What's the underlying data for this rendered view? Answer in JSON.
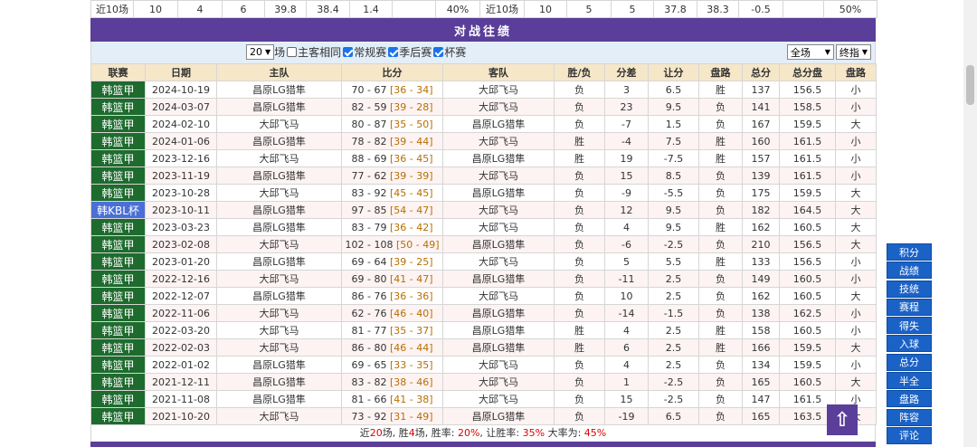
{
  "prev_row": [
    "近10场",
    "10",
    "4",
    "6",
    "39.8",
    "38.4",
    "1.4",
    "",
    "40%",
    "近10场",
    "10",
    "5",
    "5",
    "37.8",
    "38.3",
    "-0.5",
    "",
    "50%"
  ],
  "section_title": "对战往绩",
  "filters": {
    "count_select": "20",
    "count_suffix": "场",
    "same_home_label": "主客相同",
    "regular_label": "常规赛",
    "playoff_label": "季后赛",
    "cup_label": "杯赛",
    "venue_select": "全场",
    "odds_select": "终指"
  },
  "headers": [
    "联赛",
    "日期",
    "主队",
    "比分",
    "客队",
    "胜/负",
    "分差",
    "让分",
    "盘路",
    "总分",
    "总分盘",
    "盘路"
  ],
  "rows": [
    {
      "league": "韩篮甲",
      "date": "2024-10-19",
      "home": "昌原LG猎隼",
      "score": "70 - 67",
      "half": "[36 - 34]",
      "away": "大邱飞马",
      "wl": "负",
      "diff": "3",
      "handicap": "6.5",
      "hres": "胜",
      "total": "137",
      "tline": "156.5",
      "ou": "小"
    },
    {
      "league": "韩篮甲",
      "date": "2024-03-07",
      "home": "昌原LG猎隼",
      "score": "82 - 59",
      "half": "[39 - 28]",
      "away": "大邱飞马",
      "wl": "负",
      "diff": "23",
      "handicap": "9.5",
      "hres": "负",
      "total": "141",
      "tline": "158.5",
      "ou": "小"
    },
    {
      "league": "韩篮甲",
      "date": "2024-02-10",
      "home": "大邱飞马",
      "score": "80 - 87",
      "half": "[35 - 50]",
      "away": "昌原LG猎隼",
      "wl": "负",
      "diff": "-7",
      "handicap": "1.5",
      "hres": "负",
      "total": "167",
      "tline": "159.5",
      "ou": "大"
    },
    {
      "league": "韩篮甲",
      "date": "2024-01-06",
      "home": "昌原LG猎隼",
      "score": "78 - 82",
      "half": "[39 - 44]",
      "away": "大邱飞马",
      "wl": "胜",
      "diff": "-4",
      "handicap": "7.5",
      "hres": "胜",
      "total": "160",
      "tline": "161.5",
      "ou": "小"
    },
    {
      "league": "韩篮甲",
      "date": "2023-12-16",
      "home": "大邱飞马",
      "score": "88 - 69",
      "half": "[36 - 45]",
      "away": "昌原LG猎隼",
      "wl": "胜",
      "diff": "19",
      "handicap": "-7.5",
      "hres": "胜",
      "total": "157",
      "tline": "161.5",
      "ou": "小"
    },
    {
      "league": "韩篮甲",
      "date": "2023-11-19",
      "home": "昌原LG猎隼",
      "score": "77 - 62",
      "half": "[39 - 39]",
      "away": "大邱飞马",
      "wl": "负",
      "diff": "15",
      "handicap": "8.5",
      "hres": "负",
      "total": "139",
      "tline": "161.5",
      "ou": "小"
    },
    {
      "league": "韩篮甲",
      "date": "2023-10-28",
      "home": "大邱飞马",
      "score": "83 - 92",
      "half": "[45 - 45]",
      "away": "昌原LG猎隼",
      "wl": "负",
      "diff": "-9",
      "handicap": "-5.5",
      "hres": "负",
      "total": "175",
      "tline": "159.5",
      "ou": "大"
    },
    {
      "league": "韩KBL杯",
      "date": "2023-10-11",
      "home": "昌原LG猎隼",
      "score": "97 - 85",
      "half": "[54 - 47]",
      "away": "大邱飞马",
      "wl": "负",
      "diff": "12",
      "handicap": "9.5",
      "hres": "负",
      "total": "182",
      "tline": "164.5",
      "ou": "大",
      "cup": true
    },
    {
      "league": "韩篮甲",
      "date": "2023-03-23",
      "home": "昌原LG猎隼",
      "score": "83 - 79",
      "half": "[36 - 42]",
      "away": "大邱飞马",
      "wl": "负",
      "diff": "4",
      "handicap": "9.5",
      "hres": "胜",
      "total": "162",
      "tline": "160.5",
      "ou": "大"
    },
    {
      "league": "韩篮甲",
      "date": "2023-02-08",
      "home": "大邱飞马",
      "score": "102 - 108",
      "half": "[50 - 49]",
      "away": "昌原LG猎隼",
      "wl": "负",
      "diff": "-6",
      "handicap": "-2.5",
      "hres": "负",
      "total": "210",
      "tline": "156.5",
      "ou": "大"
    },
    {
      "league": "韩篮甲",
      "date": "2023-01-20",
      "home": "昌原LG猎隼",
      "score": "69 - 64",
      "half": "[39 - 25]",
      "away": "大邱飞马",
      "wl": "负",
      "diff": "5",
      "handicap": "5.5",
      "hres": "胜",
      "total": "133",
      "tline": "156.5",
      "ou": "小"
    },
    {
      "league": "韩篮甲",
      "date": "2022-12-16",
      "home": "大邱飞马",
      "score": "69 - 80",
      "half": "[41 - 47]",
      "away": "昌原LG猎隼",
      "wl": "负",
      "diff": "-11",
      "handicap": "2.5",
      "hres": "负",
      "total": "149",
      "tline": "160.5",
      "ou": "小"
    },
    {
      "league": "韩篮甲",
      "date": "2022-12-07",
      "home": "昌原LG猎隼",
      "score": "86 - 76",
      "half": "[36 - 36]",
      "away": "大邱飞马",
      "wl": "负",
      "diff": "10",
      "handicap": "2.5",
      "hres": "负",
      "total": "162",
      "tline": "160.5",
      "ou": "大"
    },
    {
      "league": "韩篮甲",
      "date": "2022-11-06",
      "home": "大邱飞马",
      "score": "62 - 76",
      "half": "[46 - 40]",
      "away": "昌原LG猎隼",
      "wl": "负",
      "diff": "-14",
      "handicap": "-1.5",
      "hres": "负",
      "total": "138",
      "tline": "162.5",
      "ou": "小"
    },
    {
      "league": "韩篮甲",
      "date": "2022-03-20",
      "home": "大邱飞马",
      "score": "81 - 77",
      "half": "[35 - 37]",
      "away": "昌原LG猎隼",
      "wl": "胜",
      "diff": "4",
      "handicap": "2.5",
      "hres": "胜",
      "total": "158",
      "tline": "160.5",
      "ou": "小"
    },
    {
      "league": "韩篮甲",
      "date": "2022-02-03",
      "home": "大邱飞马",
      "score": "86 - 80",
      "half": "[46 - 44]",
      "away": "昌原LG猎隼",
      "wl": "胜",
      "diff": "6",
      "handicap": "2.5",
      "hres": "胜",
      "total": "166",
      "tline": "159.5",
      "ou": "大"
    },
    {
      "league": "韩篮甲",
      "date": "2022-01-02",
      "home": "昌原LG猎隼",
      "score": "69 - 65",
      "half": "[33 - 35]",
      "away": "大邱飞马",
      "wl": "负",
      "diff": "4",
      "handicap": "2.5",
      "hres": "负",
      "total": "134",
      "tline": "159.5",
      "ou": "小"
    },
    {
      "league": "韩篮甲",
      "date": "2021-12-11",
      "home": "昌原LG猎隼",
      "score": "83 - 82",
      "half": "[38 - 46]",
      "away": "大邱飞马",
      "wl": "负",
      "diff": "1",
      "handicap": "-2.5",
      "hres": "负",
      "total": "165",
      "tline": "160.5",
      "ou": "大"
    },
    {
      "league": "韩篮甲",
      "date": "2021-11-08",
      "home": "昌原LG猎隼",
      "score": "81 - 66",
      "half": "[41 - 38]",
      "away": "大邱飞马",
      "wl": "负",
      "diff": "15",
      "handicap": "-2.5",
      "hres": "负",
      "total": "147",
      "tline": "161.5",
      "ou": "小"
    },
    {
      "league": "韩篮甲",
      "date": "2021-10-20",
      "home": "大邱飞马",
      "score": "73 - 92",
      "half": "[31 - 49]",
      "away": "昌原LG猎隼",
      "wl": "负",
      "diff": "-19",
      "handicap": "6.5",
      "hres": "负",
      "total": "165",
      "tline": "163.5",
      "ou": "大"
    }
  ],
  "highlight_team": "大邱飞马",
  "summary": {
    "pre": "近",
    "games": "20",
    "mid1": "场, 胜",
    "wins": "4",
    "mid2": "场, 胜率: ",
    "win_rate": "20%",
    "mid3": ", 让胜率: ",
    "handicap_rate": "35%",
    "mid4": " 大率为: ",
    "over_rate": "45%"
  },
  "side_nav": [
    "积分",
    "战绩",
    "技统",
    "赛程",
    "得失",
    "入球",
    "总分",
    "半全",
    "盘路",
    "阵容",
    "评论"
  ],
  "up_icon": "⇧"
}
